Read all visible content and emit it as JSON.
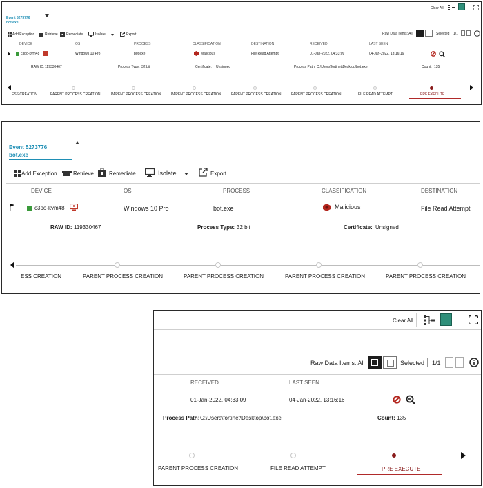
{
  "event": {
    "title": "Event 5273776",
    "subtitle": "bot.exe"
  },
  "toolbar": {
    "add_exception": "Add Exception",
    "retrieve": "Retrieve",
    "remediate": "Remediate",
    "isolate": "Isolate",
    "export": "Export",
    "clear_all": "Clear All",
    "raw_data_items": "Raw Data Items: All",
    "selected": "Selected",
    "page": "1/1"
  },
  "columns": {
    "device": "DEVICE",
    "os": "OS",
    "process": "PROCESS",
    "classification": "CLASSIFICATION",
    "destination": "DESTINATION",
    "received": "RECEIVED",
    "last_seen": "LAST SEEN"
  },
  "row": {
    "device": "c3po-kvm48",
    "os": "Windows 10 Pro",
    "process": "bot.exe",
    "classification": "Malicious",
    "destination": "File Read Attempt",
    "received": "01-Jan-2022, 04:33:09",
    "last_seen": "04-Jan-2022, 13:16:16"
  },
  "details": {
    "raw_id_label": "RAW ID:",
    "raw_id": "119330467",
    "process_type_label": "Process Type:",
    "process_type": "32 bit",
    "certificate_label": "Certificate:",
    "certificate": "Unsigned",
    "process_path_label": "Process Path:",
    "process_path": "C:\\Users\\fortinet\\Desktop\\bot.exe",
    "count_label": "Count:",
    "count": "135"
  },
  "timeline": {
    "ess_creation": "ESS CREATION",
    "parent_process_creation": "PARENT PROCESS CREATION",
    "file_read_attempt": "FILE READ ATTEMPT",
    "pre_execute": "PRE EXECUTE"
  },
  "colors": {
    "accent": "#1f8fb5",
    "malicious": "#b3261e",
    "active": "#8a1c1c",
    "teal": "#2f8f7a"
  },
  "icons": [
    "flag-icon",
    "device-icon",
    "monitor-alert-icon",
    "malicious-icon",
    "block-icon",
    "search-zoom-icon",
    "grid-icon",
    "trash-icon",
    "toolbox-icon",
    "monitor-icon",
    "export-icon",
    "tree-icon",
    "list-view-icon",
    "expand-icon",
    "info-icon"
  ]
}
